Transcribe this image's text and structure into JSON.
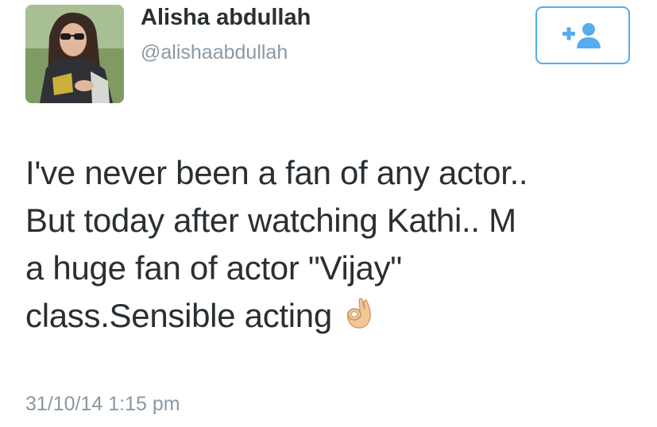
{
  "author": {
    "name": "Alisha abdullah",
    "handle": "@alishaabdullah"
  },
  "follow_button": {
    "icon": "add-user-icon",
    "label": "+",
    "color": "#55acee"
  },
  "tweet": {
    "lines": [
      "I've never been a fan of any actor..",
      "But today after watching Kathi.. M",
      "a huge fan of actor \"Vijay\"",
      "class.Sensible acting"
    ],
    "emoji": "ok-hand-emoji"
  },
  "timestamp": "31/10/14 1:15 pm",
  "colors": {
    "text": "#292f33",
    "muted": "#8899a6",
    "accent": "#55acee"
  }
}
